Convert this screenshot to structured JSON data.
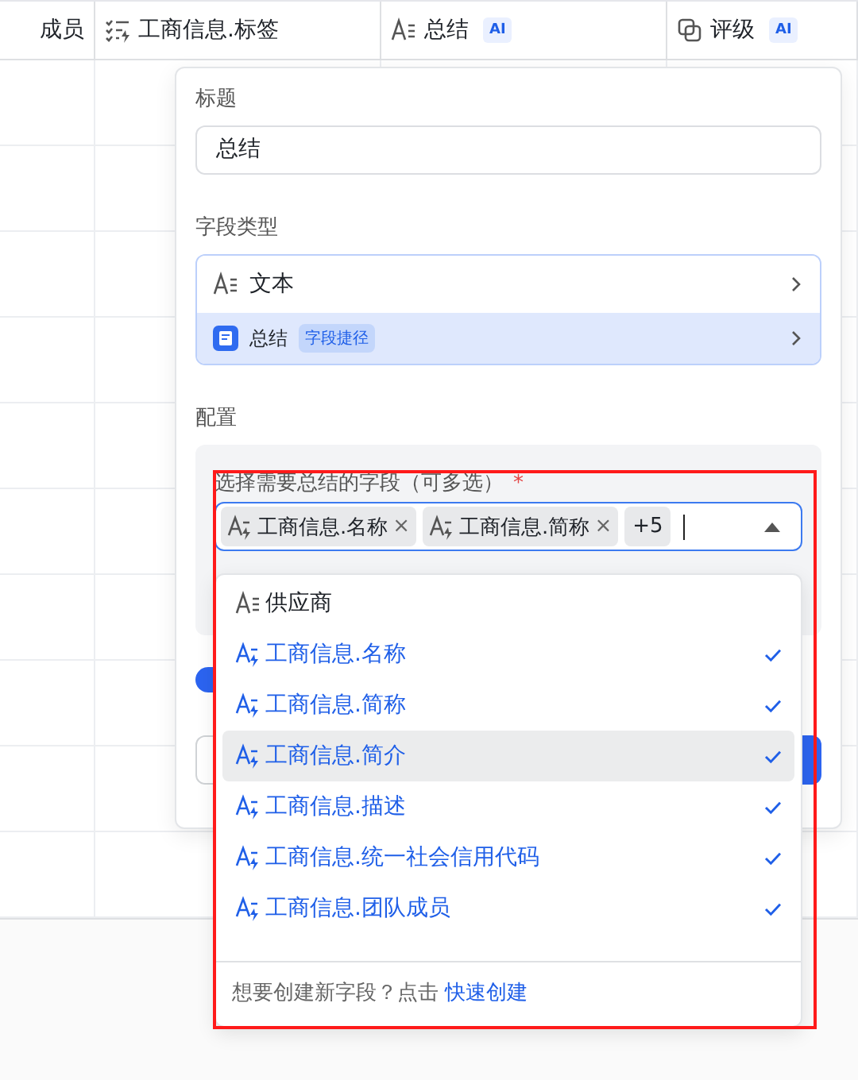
{
  "table": {
    "columns": [
      {
        "label": "成员",
        "kind": "plain"
      },
      {
        "label": "工商信息.标签",
        "kind": "ai_tags"
      },
      {
        "label": "总结",
        "kind": "text",
        "badge": "AI"
      },
      {
        "label": "评级",
        "kind": "rating",
        "badge": "AI"
      }
    ]
  },
  "panel": {
    "title_label": "标题",
    "title_value": "总结",
    "type_label": "字段类型",
    "types": [
      {
        "label": "文本",
        "kind": "text",
        "selected": false
      },
      {
        "label": "总结",
        "kind": "app",
        "badge": "字段捷径",
        "selected": true
      }
    ],
    "config_label": "配置",
    "select_label": "选择需要总结的字段（可多选）",
    "required_mark": "*",
    "tags": [
      {
        "label": "工商信息.名称",
        "remove": "×"
      },
      {
        "label": "工商信息.简称",
        "remove": "×"
      }
    ],
    "more": "+5",
    "toggle": {
      "on": true
    }
  },
  "dropdown": {
    "options": [
      {
        "label": "供应商",
        "kind": "text",
        "checked": false,
        "highlighted": false
      },
      {
        "label": "工商信息.名称",
        "kind": "ai_text",
        "checked": true,
        "highlighted": false
      },
      {
        "label": "工商信息.简称",
        "kind": "ai_text",
        "checked": true,
        "highlighted": false
      },
      {
        "label": "工商信息.简介",
        "kind": "ai_text",
        "checked": true,
        "highlighted": true
      },
      {
        "label": "工商信息.描述",
        "kind": "ai_text",
        "checked": true,
        "highlighted": false
      },
      {
        "label": "工商信息.统一社会信用代码",
        "kind": "ai_text",
        "checked": true,
        "highlighted": false
      },
      {
        "label": "工商信息.团队成员",
        "kind": "ai_text",
        "checked": true,
        "highlighted": false
      }
    ],
    "footer_text": "想要创建新字段？点击 ",
    "footer_link": "快速创建"
  }
}
